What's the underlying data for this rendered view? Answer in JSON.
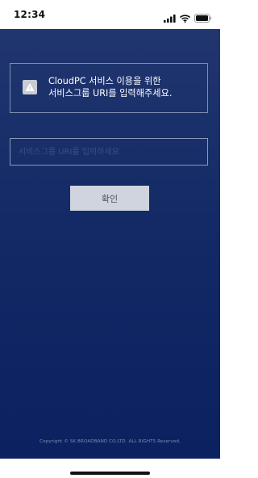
{
  "status_bar": {
    "time": "12:34",
    "icons": [
      "signal-bars-icon",
      "wifi-icon",
      "battery-icon"
    ]
  },
  "notice": {
    "icon": "warning-icon",
    "line1": "CloudPC 서비스 이용을 위한",
    "line2": "서비스그룹 URI를 입력해주세요."
  },
  "uri_input": {
    "value": "",
    "placeholder": "서비스그룹 URI를 입력하세요"
  },
  "confirm_button": {
    "label": "확인"
  },
  "footer": {
    "copyright": "Copyright © SK BROADBAND CO.LTD. ALL RIGHTS Reserved."
  },
  "colors": {
    "background_top": "#21366f",
    "background_bottom": "#0c2160",
    "button_bg": "#d0d4de",
    "text": "#ffffff"
  }
}
